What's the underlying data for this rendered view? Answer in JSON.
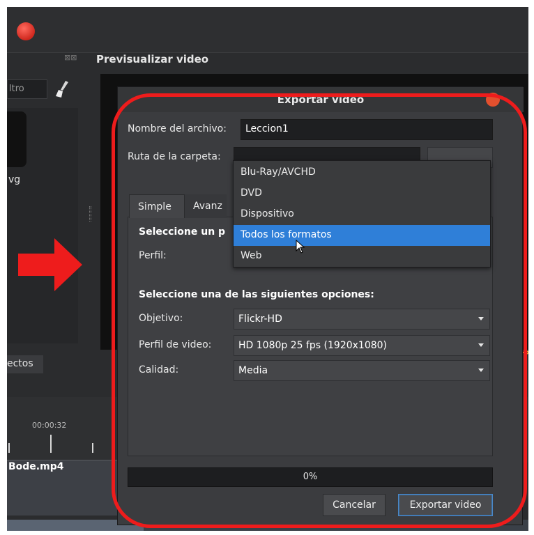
{
  "colors": {
    "accent": "#2f7fd8",
    "highlight": "#ee1c1c",
    "window_bg": "#2b2c2e",
    "dialog_bg": "#3b3c3f"
  },
  "left_panel": {
    "filter_text": "ltro",
    "thumb_label": "vg",
    "effects_tab": "ectos"
  },
  "preview": {
    "title": "Previsualizar video",
    "icons": "⊠⊠"
  },
  "timeline": {
    "time_label": "00:00:32",
    "clip_label": "Bode.mp4"
  },
  "dialog": {
    "title": "Exportar video",
    "file_name_label": "Nombre del archivo:",
    "file_name_value": "Leccion1",
    "folder_label": "Ruta de la carpeta:",
    "tabs": [
      {
        "label": "Simple"
      },
      {
        "label": "Avanz"
      }
    ],
    "section1": "Seleccione un p",
    "profile_label": "Perfil:",
    "section2": "Seleccione una de las siguientes opciones:",
    "target_label": "Objetivo:",
    "target_value": "Flickr-HD",
    "video_profile_label": "Perfil de video:",
    "video_profile_value": "HD 1080p 25 fps (1920x1080)",
    "quality_label": "Calidad:",
    "quality_value": "Media",
    "progress_text": "0%",
    "progress": 0,
    "cancel_label": "Cancelar",
    "export_label": "Exportar video"
  },
  "dropdown": {
    "items": [
      {
        "label": "Blu-Ray/AVCHD"
      },
      {
        "label": "DVD"
      },
      {
        "label": "Dispositivo"
      },
      {
        "label": "Todos los formatos"
      },
      {
        "label": "Web"
      }
    ],
    "selected": "Todos los formatos"
  }
}
